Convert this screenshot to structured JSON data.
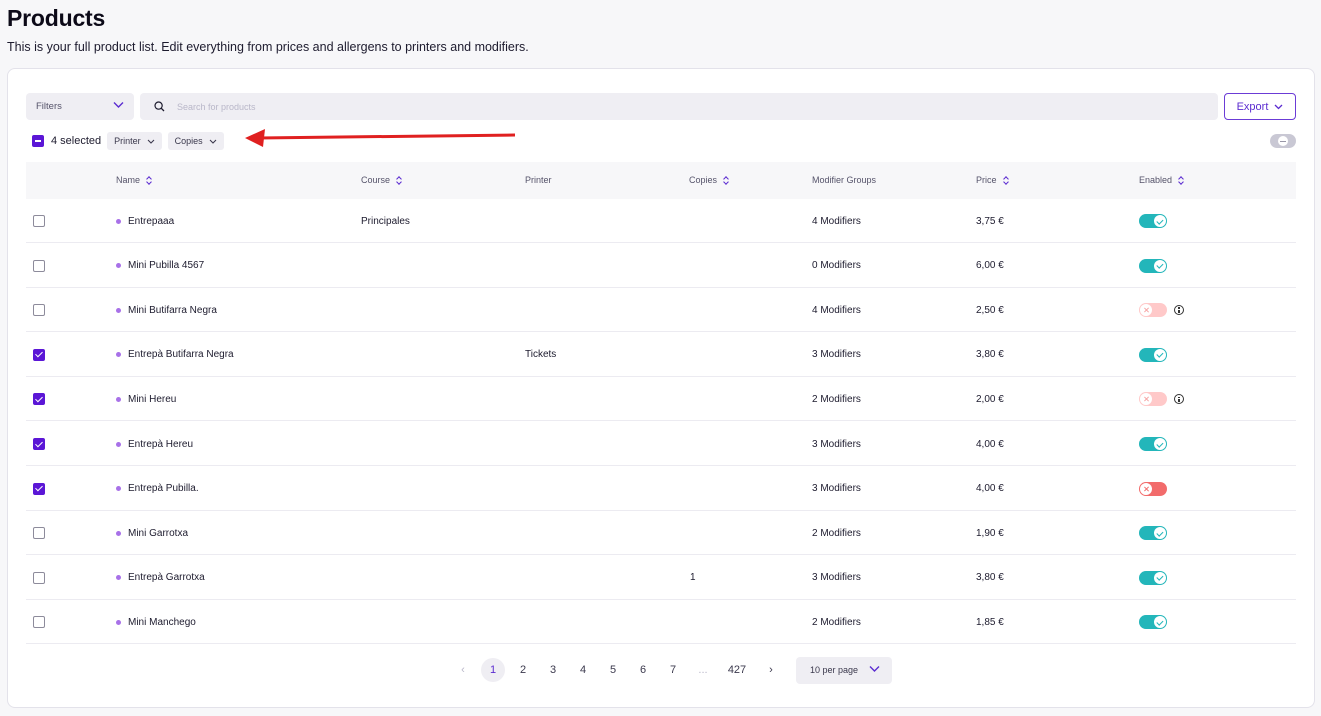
{
  "header": {
    "title": "Products",
    "subtitle": "This is your full product list. Edit everything from prices and allergens to printers and modifiers."
  },
  "toolbar": {
    "filters_label": "Filters",
    "search_placeholder": "Search for products",
    "export_label": "Export"
  },
  "bulk": {
    "selected_label": "4 selected",
    "chips": [
      "Printer",
      "Copies"
    ]
  },
  "annotation": {
    "arrow_color": "#e02020"
  },
  "table": {
    "columns": {
      "name": "Name",
      "course": "Course",
      "printer": "Printer",
      "copies": "Copies",
      "modifiers": "Modifier Groups",
      "price": "Price",
      "enabled": "Enabled"
    },
    "rows": [
      {
        "checked": false,
        "name": "Entrepaaa",
        "course": "Principales",
        "printer": "",
        "copies": "",
        "modifiers": "4 Modifiers",
        "price": "3,75 €",
        "enabled": true,
        "info": false
      },
      {
        "checked": false,
        "name": "Mini Pubilla 4567",
        "course": "",
        "printer": "",
        "copies": "",
        "modifiers": "0 Modifiers",
        "price": "6,00 €",
        "enabled": true,
        "info": false
      },
      {
        "checked": false,
        "name": "Mini Butifarra Negra",
        "course": "",
        "printer": "",
        "copies": "",
        "modifiers": "4 Modifiers",
        "price": "2,50 €",
        "enabled": false,
        "info": true
      },
      {
        "checked": true,
        "name": "Entrepà Butifarra Negra",
        "course": "",
        "printer": "Tickets",
        "copies": "",
        "modifiers": "3 Modifiers",
        "price": "3,80 €",
        "enabled": true,
        "info": false
      },
      {
        "checked": true,
        "name": "Mini Hereu",
        "course": "",
        "printer": "",
        "copies": "",
        "modifiers": "2 Modifiers",
        "price": "2,00 €",
        "enabled": false,
        "info": true
      },
      {
        "checked": true,
        "name": "Entrepà Hereu",
        "course": "",
        "printer": "",
        "copies": "",
        "modifiers": "3 Modifiers",
        "price": "4,00 €",
        "enabled": true,
        "info": false
      },
      {
        "checked": true,
        "name": "Entrepà Pubilla.",
        "course": "",
        "printer": "",
        "copies": "",
        "modifiers": "3 Modifiers",
        "price": "4,00 €",
        "enabled": false,
        "info": false,
        "strong_off": true
      },
      {
        "checked": false,
        "name": "Mini Garrotxa",
        "course": "",
        "printer": "",
        "copies": "",
        "modifiers": "2 Modifiers",
        "price": "1,90 €",
        "enabled": true,
        "info": false
      },
      {
        "checked": false,
        "name": "Entrepà Garrotxa",
        "course": "",
        "printer": "",
        "copies": "1",
        "modifiers": "3 Modifiers",
        "price": "3,80 €",
        "enabled": true,
        "info": false
      },
      {
        "checked": false,
        "name": "Mini Manchego",
        "course": "",
        "printer": "",
        "copies": "",
        "modifiers": "2 Modifiers",
        "price": "1,85 €",
        "enabled": true,
        "info": false
      }
    ]
  },
  "pagination": {
    "prev": "‹",
    "next": "›",
    "pages": [
      "1",
      "2",
      "3",
      "4",
      "5",
      "6",
      "7",
      "...",
      "427"
    ],
    "current": "1",
    "per_page": "10 per page"
  },
  "colors": {
    "accent": "#5b16d6",
    "enabled": "#23b6ba",
    "disabled": "#ffc9c9",
    "dot": "#a871e8"
  }
}
